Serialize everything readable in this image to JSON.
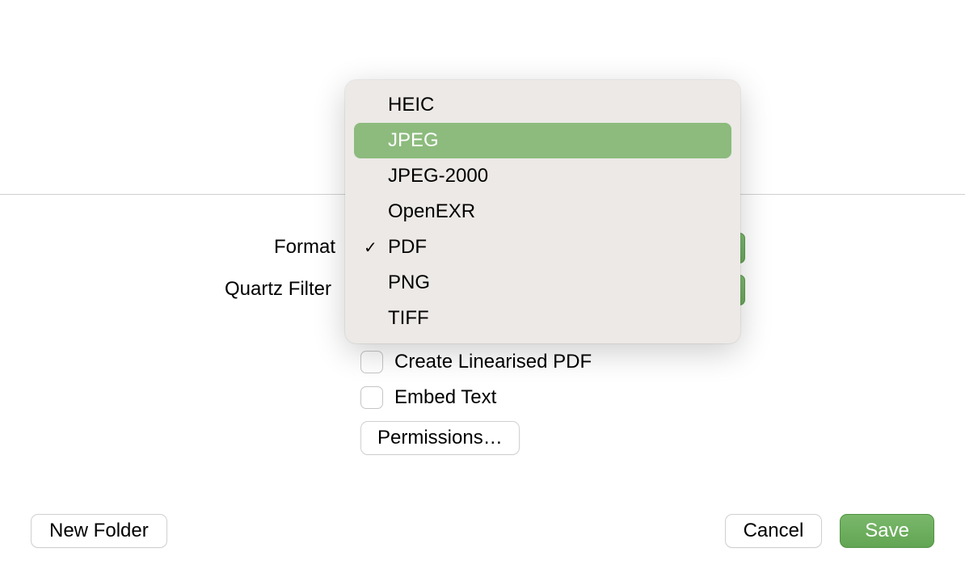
{
  "labels": {
    "format": "Format",
    "quartz_filter": "Quartz Filter"
  },
  "checkboxes": {
    "create_linearised_pdf": "Create Linearised PDF",
    "embed_text": "Embed Text"
  },
  "buttons": {
    "permissions": "Permissions…",
    "new_folder": "New Folder",
    "cancel": "Cancel",
    "save": "Save"
  },
  "format_dropdown": {
    "items": [
      "HEIC",
      "JPEG",
      "JPEG-2000",
      "OpenEXR",
      "PDF",
      "PNG",
      "TIFF"
    ],
    "highlighted": "JPEG",
    "checked": "PDF"
  },
  "colors": {
    "accent_green": "#6ba85d",
    "dropdown_bg": "#ece9e6",
    "highlight": "#8cbb7d"
  }
}
